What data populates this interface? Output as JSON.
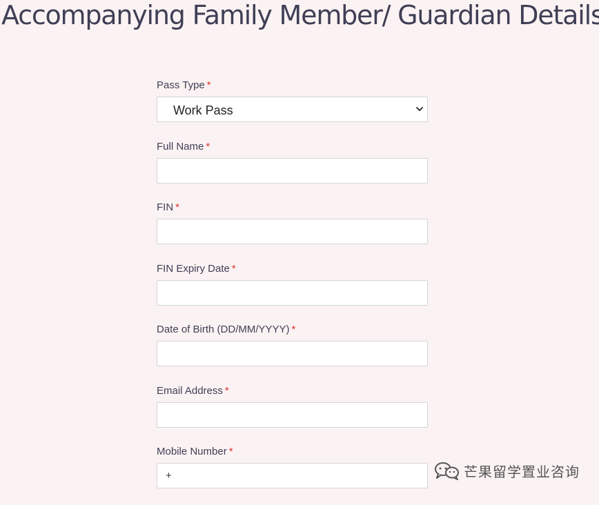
{
  "page": {
    "title": "Accompanying Family Member/ Guardian Details"
  },
  "form": {
    "required_marker": "*",
    "pass_type": {
      "label": "Pass Type",
      "selected": "Work Pass"
    },
    "full_name": {
      "label": "Full Name",
      "value": ""
    },
    "fin": {
      "label": "FIN",
      "value": ""
    },
    "fin_expiry": {
      "label": "FIN Expiry Date",
      "value": ""
    },
    "dob": {
      "label": "Date of Birth (DD/MM/YYYY)",
      "value": ""
    },
    "email": {
      "label": "Email Address",
      "value": ""
    },
    "mobile": {
      "label": "Mobile Number",
      "prefix": "+"
    }
  },
  "watermark": {
    "text": "芒果留学置业咨询",
    "icon": "wechat-icon"
  },
  "colors": {
    "background": "#fbf2f3",
    "text": "#3f3f55",
    "required": "#e0342c",
    "border": "#d4d4d4"
  }
}
